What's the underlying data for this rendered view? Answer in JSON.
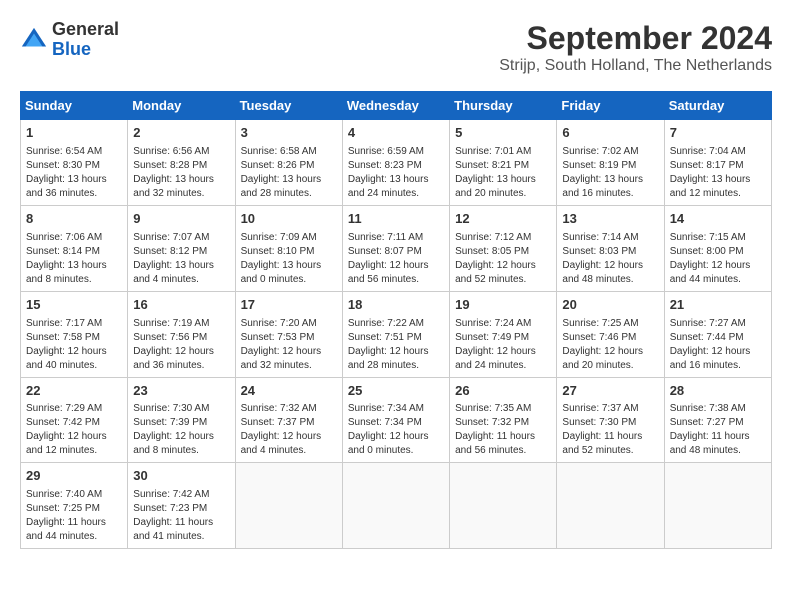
{
  "logo": {
    "line1": "General",
    "line2": "Blue"
  },
  "header": {
    "month_year": "September 2024",
    "location": "Strijp, South Holland, The Netherlands"
  },
  "weekdays": [
    "Sunday",
    "Monday",
    "Tuesday",
    "Wednesday",
    "Thursday",
    "Friday",
    "Saturday"
  ],
  "weeks": [
    [
      {
        "day": "1",
        "info": "Sunrise: 6:54 AM\nSunset: 8:30 PM\nDaylight: 13 hours\nand 36 minutes."
      },
      {
        "day": "2",
        "info": "Sunrise: 6:56 AM\nSunset: 8:28 PM\nDaylight: 13 hours\nand 32 minutes."
      },
      {
        "day": "3",
        "info": "Sunrise: 6:58 AM\nSunset: 8:26 PM\nDaylight: 13 hours\nand 28 minutes."
      },
      {
        "day": "4",
        "info": "Sunrise: 6:59 AM\nSunset: 8:23 PM\nDaylight: 13 hours\nand 24 minutes."
      },
      {
        "day": "5",
        "info": "Sunrise: 7:01 AM\nSunset: 8:21 PM\nDaylight: 13 hours\nand 20 minutes."
      },
      {
        "day": "6",
        "info": "Sunrise: 7:02 AM\nSunset: 8:19 PM\nDaylight: 13 hours\nand 16 minutes."
      },
      {
        "day": "7",
        "info": "Sunrise: 7:04 AM\nSunset: 8:17 PM\nDaylight: 13 hours\nand 12 minutes."
      }
    ],
    [
      {
        "day": "8",
        "info": "Sunrise: 7:06 AM\nSunset: 8:14 PM\nDaylight: 13 hours\nand 8 minutes."
      },
      {
        "day": "9",
        "info": "Sunrise: 7:07 AM\nSunset: 8:12 PM\nDaylight: 13 hours\nand 4 minutes."
      },
      {
        "day": "10",
        "info": "Sunrise: 7:09 AM\nSunset: 8:10 PM\nDaylight: 13 hours\nand 0 minutes."
      },
      {
        "day": "11",
        "info": "Sunrise: 7:11 AM\nSunset: 8:07 PM\nDaylight: 12 hours\nand 56 minutes."
      },
      {
        "day": "12",
        "info": "Sunrise: 7:12 AM\nSunset: 8:05 PM\nDaylight: 12 hours\nand 52 minutes."
      },
      {
        "day": "13",
        "info": "Sunrise: 7:14 AM\nSunset: 8:03 PM\nDaylight: 12 hours\nand 48 minutes."
      },
      {
        "day": "14",
        "info": "Sunrise: 7:15 AM\nSunset: 8:00 PM\nDaylight: 12 hours\nand 44 minutes."
      }
    ],
    [
      {
        "day": "15",
        "info": "Sunrise: 7:17 AM\nSunset: 7:58 PM\nDaylight: 12 hours\nand 40 minutes."
      },
      {
        "day": "16",
        "info": "Sunrise: 7:19 AM\nSunset: 7:56 PM\nDaylight: 12 hours\nand 36 minutes."
      },
      {
        "day": "17",
        "info": "Sunrise: 7:20 AM\nSunset: 7:53 PM\nDaylight: 12 hours\nand 32 minutes."
      },
      {
        "day": "18",
        "info": "Sunrise: 7:22 AM\nSunset: 7:51 PM\nDaylight: 12 hours\nand 28 minutes."
      },
      {
        "day": "19",
        "info": "Sunrise: 7:24 AM\nSunset: 7:49 PM\nDaylight: 12 hours\nand 24 minutes."
      },
      {
        "day": "20",
        "info": "Sunrise: 7:25 AM\nSunset: 7:46 PM\nDaylight: 12 hours\nand 20 minutes."
      },
      {
        "day": "21",
        "info": "Sunrise: 7:27 AM\nSunset: 7:44 PM\nDaylight: 12 hours\nand 16 minutes."
      }
    ],
    [
      {
        "day": "22",
        "info": "Sunrise: 7:29 AM\nSunset: 7:42 PM\nDaylight: 12 hours\nand 12 minutes."
      },
      {
        "day": "23",
        "info": "Sunrise: 7:30 AM\nSunset: 7:39 PM\nDaylight: 12 hours\nand 8 minutes."
      },
      {
        "day": "24",
        "info": "Sunrise: 7:32 AM\nSunset: 7:37 PM\nDaylight: 12 hours\nand 4 minutes."
      },
      {
        "day": "25",
        "info": "Sunrise: 7:34 AM\nSunset: 7:34 PM\nDaylight: 12 hours\nand 0 minutes."
      },
      {
        "day": "26",
        "info": "Sunrise: 7:35 AM\nSunset: 7:32 PM\nDaylight: 11 hours\nand 56 minutes."
      },
      {
        "day": "27",
        "info": "Sunrise: 7:37 AM\nSunset: 7:30 PM\nDaylight: 11 hours\nand 52 minutes."
      },
      {
        "day": "28",
        "info": "Sunrise: 7:38 AM\nSunset: 7:27 PM\nDaylight: 11 hours\nand 48 minutes."
      }
    ],
    [
      {
        "day": "29",
        "info": "Sunrise: 7:40 AM\nSunset: 7:25 PM\nDaylight: 11 hours\nand 44 minutes."
      },
      {
        "day": "30",
        "info": "Sunrise: 7:42 AM\nSunset: 7:23 PM\nDaylight: 11 hours\nand 41 minutes."
      },
      {
        "day": "",
        "info": ""
      },
      {
        "day": "",
        "info": ""
      },
      {
        "day": "",
        "info": ""
      },
      {
        "day": "",
        "info": ""
      },
      {
        "day": "",
        "info": ""
      }
    ]
  ]
}
